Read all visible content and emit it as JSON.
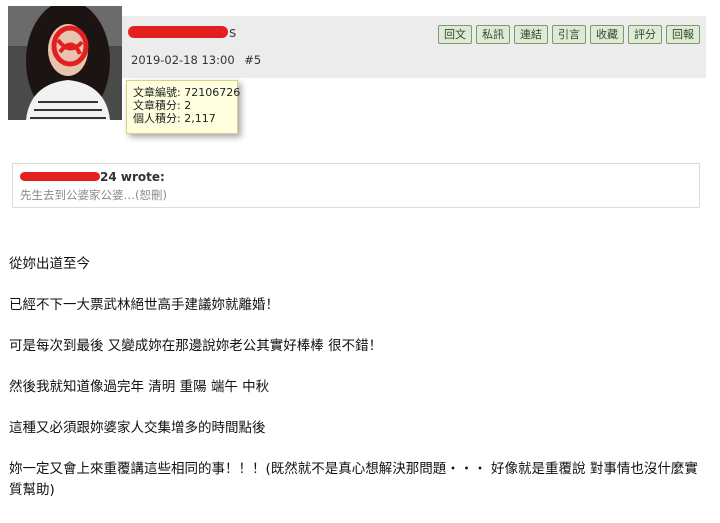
{
  "post": {
    "username_tail": "s",
    "datetime": "2019-02-18 13:00",
    "post_number": "#5",
    "actions": [
      "回文",
      "私訊",
      "連結",
      "引言",
      "收藏",
      "評分",
      "回報"
    ]
  },
  "user_tooltip": {
    "article_id": "文章編號: 72106726",
    "article_score": "文章積分: 2",
    "personal_score": "個人積分: 2,117"
  },
  "quote": {
    "author_tail": "24 wrote:",
    "text": "先生去到公婆家公婆…(恕刪)"
  },
  "paragraphs": [
    "從妳出道至今",
    "已經不下一大票武林絕世高手建議妳就離婚！",
    "可是每次到最後 又變成妳在那邊說妳老公其實好棒棒 很不錯！",
    "然後我就知道像過完年 清明 重陽 端午 中秋",
    "這種又必須跟妳婆家人交集增多的時間點後",
    "妳一定又會上來重覆講這些相同的事！！！(既然就不是真心想解決那問題・・・ 好像就是重覆說 對事情也沒什麼實質幫助)"
  ],
  "colors": {
    "header_bg": "#ececec",
    "button_bg": "#dfe9d7",
    "button_border": "#7a9c6a",
    "tooltip_bg": "#ffffe0",
    "redaction": "#e32020"
  }
}
